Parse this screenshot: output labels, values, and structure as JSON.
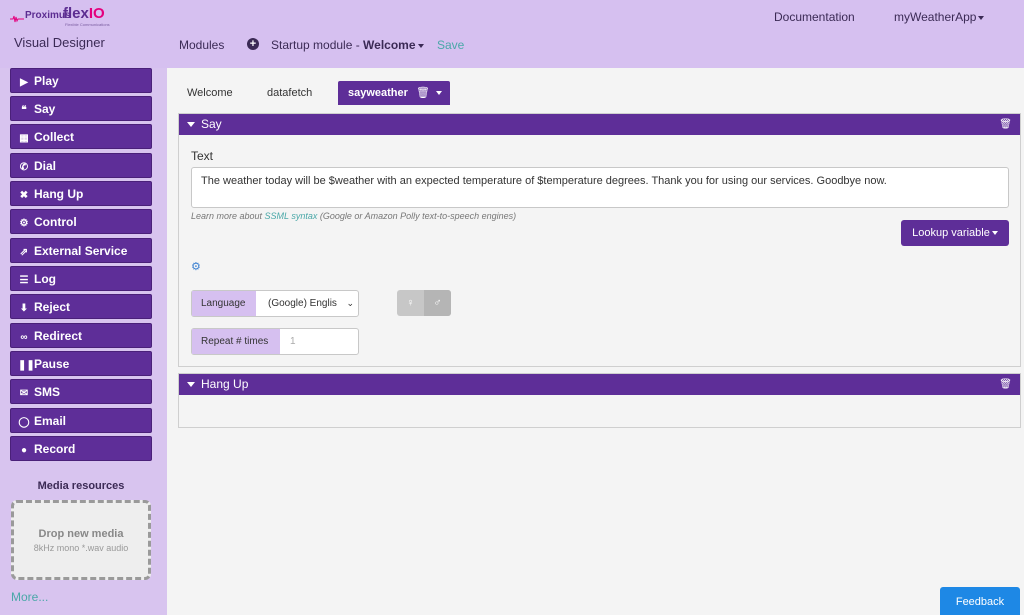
{
  "brand": {
    "name_part1": "Proximus",
    "name_part2": "flex",
    "name_part3": "IO",
    "tagline": "Flexible Communications"
  },
  "header": {
    "app_title": "Visual Designer",
    "documentation": "Documentation",
    "app_menu": "myWeatherApp"
  },
  "breadcrumb": {
    "modules": "Modules",
    "startup_prefix": "Startup module - ",
    "startup_name": "Welcome",
    "save": "Save"
  },
  "sidebar": {
    "items": [
      {
        "label": "Play",
        "icon": "play-icon"
      },
      {
        "label": "Say",
        "icon": "quote-icon"
      },
      {
        "label": "Collect",
        "icon": "keypad-icon"
      },
      {
        "label": "Dial",
        "icon": "phone-icon"
      },
      {
        "label": "Hang Up",
        "icon": "close-icon"
      },
      {
        "label": "Control",
        "icon": "gears-icon"
      },
      {
        "label": "External Service",
        "icon": "external-link-icon"
      },
      {
        "label": "Log",
        "icon": "list-icon"
      },
      {
        "label": "Reject",
        "icon": "thumbs-down-icon"
      },
      {
        "label": "Redirect",
        "icon": "link-icon"
      },
      {
        "label": "Pause",
        "icon": "pause-icon"
      },
      {
        "label": "SMS",
        "icon": "envelope-icon"
      },
      {
        "label": "Email",
        "icon": "comment-icon"
      },
      {
        "label": "Record",
        "icon": "microphone-icon"
      }
    ],
    "media_title": "Media resources",
    "dropzone_title": "Drop new media",
    "dropzone_hint": "8kHz mono *.wav audio",
    "more": "More..."
  },
  "tabs": {
    "welcome": "Welcome",
    "datafetch": "datafetch",
    "active": "sayweather"
  },
  "say_block": {
    "title": "Say",
    "text_label": "Text",
    "text_value": "The weather today will be $weather with an expected temperature of $temperature degrees. Thank you for using our services. Goodbye now.",
    "hint_prefix": "Learn more about ",
    "hint_link": "SSML syntax",
    "hint_suffix": " (Google or Amazon Polly text-to-speech engines)",
    "lookup_label": "Lookup variable",
    "language_label": "Language",
    "language_value": "(Google) Englis",
    "repeat_label": "Repeat # times",
    "repeat_placeholder": "1"
  },
  "hang_block": {
    "title": "Hang Up"
  },
  "feedback": "Feedback",
  "colors": {
    "accent": "#5e2e98",
    "sidebar_bg": "#d8c4ef",
    "link": "#4aa8a8",
    "feedback": "#1e88e5"
  }
}
